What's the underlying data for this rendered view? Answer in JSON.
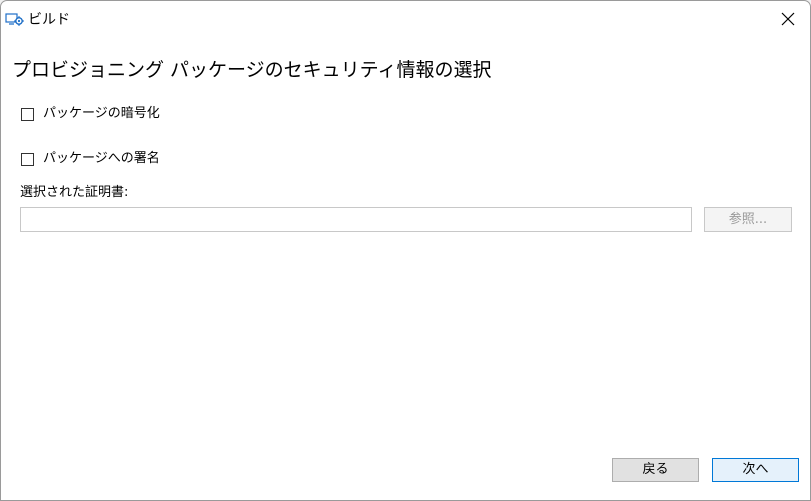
{
  "window": {
    "title": "ビルド",
    "icon": "build-gear-icon",
    "close_glyph": "✕"
  },
  "page": {
    "heading": "プロビジョニング パッケージのセキュリティ情報の選択"
  },
  "options": {
    "encrypt": {
      "label": "パッケージの暗号化",
      "checked": false
    },
    "sign": {
      "label": "パッケージへの署名",
      "checked": false
    }
  },
  "certificate": {
    "label": "選択された証明書:",
    "value": "",
    "browse_label": "参照...",
    "browse_enabled": false
  },
  "footer": {
    "back_label": "戻る",
    "next_label": "次へ"
  },
  "colors": {
    "accent": "#0078d7",
    "icon_blue": "#1e6fc7",
    "disabled_text": "#9a9a9a"
  }
}
